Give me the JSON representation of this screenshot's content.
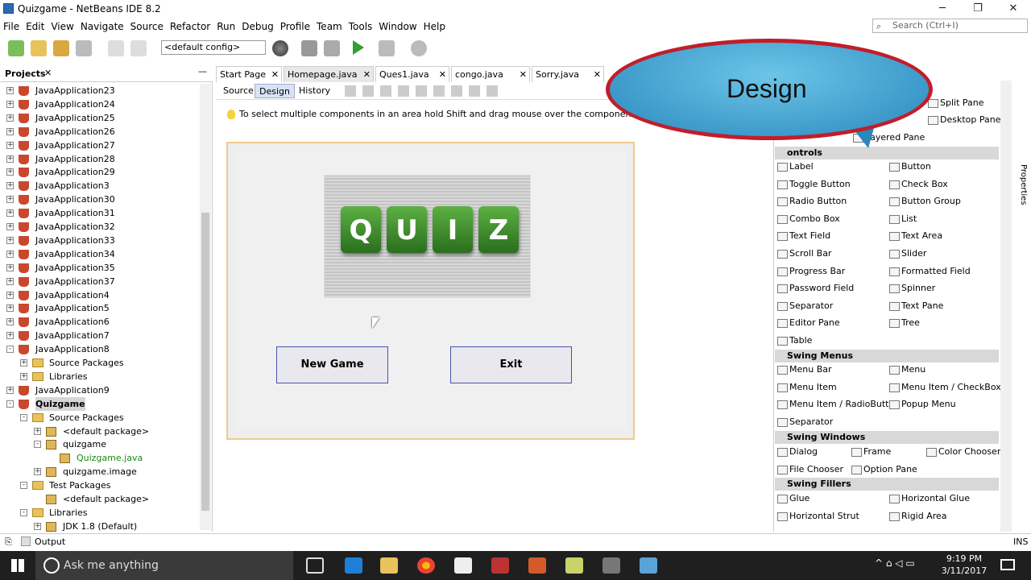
{
  "window": {
    "title": "Quizgame - NetBeans IDE 8.2"
  },
  "menubar": {
    "items": [
      "File",
      "Edit",
      "View",
      "Navigate",
      "Source",
      "Refactor",
      "Run",
      "Debug",
      "Profile",
      "Team",
      "Tools",
      "Window",
      "Help"
    ]
  },
  "search": {
    "placeholder": "Search (Ctrl+I)"
  },
  "toolbar": {
    "config": "<default config>"
  },
  "projects": {
    "title": "Projects",
    "items": [
      {
        "label": "JavaApplication23",
        "level": 0,
        "kind": "project",
        "exp": "+"
      },
      {
        "label": "JavaApplication24",
        "level": 0,
        "kind": "project",
        "exp": "+"
      },
      {
        "label": "JavaApplication25",
        "level": 0,
        "kind": "project",
        "exp": "+"
      },
      {
        "label": "JavaApplication26",
        "level": 0,
        "kind": "project",
        "exp": "+"
      },
      {
        "label": "JavaApplication27",
        "level": 0,
        "kind": "project",
        "exp": "+"
      },
      {
        "label": "JavaApplication28",
        "level": 0,
        "kind": "project",
        "exp": "+"
      },
      {
        "label": "JavaApplication29",
        "level": 0,
        "kind": "project",
        "exp": "+"
      },
      {
        "label": "JavaApplication3",
        "level": 0,
        "kind": "project",
        "exp": "+"
      },
      {
        "label": "JavaApplication30",
        "level": 0,
        "kind": "project",
        "exp": "+"
      },
      {
        "label": "JavaApplication31",
        "level": 0,
        "kind": "project",
        "exp": "+"
      },
      {
        "label": "JavaApplication32",
        "level": 0,
        "kind": "project",
        "exp": "+"
      },
      {
        "label": "JavaApplication33",
        "level": 0,
        "kind": "project",
        "exp": "+"
      },
      {
        "label": "JavaApplication34",
        "level": 0,
        "kind": "project",
        "exp": "+"
      },
      {
        "label": "JavaApplication35",
        "level": 0,
        "kind": "project",
        "exp": "+"
      },
      {
        "label": "JavaApplication37",
        "level": 0,
        "kind": "project",
        "exp": "+"
      },
      {
        "label": "JavaApplication4",
        "level": 0,
        "kind": "project",
        "exp": "+"
      },
      {
        "label": "JavaApplication5",
        "level": 0,
        "kind": "project",
        "exp": "+"
      },
      {
        "label": "JavaApplication6",
        "level": 0,
        "kind": "project",
        "exp": "+"
      },
      {
        "label": "JavaApplication7",
        "level": 0,
        "kind": "project",
        "exp": "+"
      },
      {
        "label": "JavaApplication8",
        "level": 0,
        "kind": "project",
        "exp": "-"
      },
      {
        "label": "Source Packages",
        "level": 1,
        "kind": "folder",
        "exp": "+"
      },
      {
        "label": "Libraries",
        "level": 1,
        "kind": "folder",
        "exp": "+"
      },
      {
        "label": "JavaApplication9",
        "level": 0,
        "kind": "project",
        "exp": "+"
      },
      {
        "label": "Quizgame",
        "level": 0,
        "kind": "project",
        "exp": "-",
        "bold": true
      },
      {
        "label": "Source Packages",
        "level": 1,
        "kind": "folder",
        "exp": "-"
      },
      {
        "label": "<default package>",
        "level": 2,
        "kind": "pkg",
        "exp": "+"
      },
      {
        "label": "quizgame",
        "level": 2,
        "kind": "pkg",
        "exp": "-"
      },
      {
        "label": "Quizgame.java",
        "level": 3,
        "kind": "file",
        "exp": "",
        "green": true
      },
      {
        "label": "quizgame.image",
        "level": 2,
        "kind": "pkg",
        "exp": "+"
      },
      {
        "label": "Test Packages",
        "level": 1,
        "kind": "folder",
        "exp": "-"
      },
      {
        "label": "<default package>",
        "level": 2,
        "kind": "pkg",
        "exp": ""
      },
      {
        "label": "Libraries",
        "level": 1,
        "kind": "folder",
        "exp": "-"
      },
      {
        "label": "JDK 1.8 (Default)",
        "level": 2,
        "kind": "pkg",
        "exp": "+"
      }
    ]
  },
  "editor": {
    "tabs": [
      "Start Page",
      "Homepage.java",
      "Ques1.java",
      "congo.java",
      "Sorry.java"
    ],
    "subtabs": [
      "Source",
      "Design",
      "History"
    ],
    "hint": "To select multiple components in an area hold Shift and drag mouse over the components.",
    "quiz_letters": [
      "Q",
      "U",
      "I",
      "Z"
    ],
    "new_game_label": "New Game",
    "exit_label": "Exit"
  },
  "bubble": {
    "text": "Design"
  },
  "palette": {
    "top_items": [
      "Split Pane",
      "Desktop Pane",
      "Layered Pane"
    ],
    "swing_controls_partial": "ontrols",
    "controls": [
      [
        "Label",
        "Button"
      ],
      [
        "Toggle Button",
        "Check Box"
      ],
      [
        "Radio Button",
        "Button Group"
      ],
      [
        "Combo Box",
        "List"
      ],
      [
        "Text Field",
        "Text Area"
      ],
      [
        "Scroll Bar",
        "Slider"
      ],
      [
        "Progress Bar",
        "Formatted Field"
      ],
      [
        "Password Field",
        "Spinner"
      ],
      [
        "Separator",
        "Text Pane"
      ],
      [
        "Editor Pane",
        "Tree"
      ],
      [
        "Table",
        ""
      ]
    ],
    "menus_header": "Swing Menus",
    "menus": [
      [
        "Menu Bar",
        "Menu"
      ],
      [
        "Menu Item",
        "Menu Item / CheckBox"
      ],
      [
        "Menu Item / RadioButton",
        "Popup Menu"
      ],
      [
        "Separator",
        ""
      ]
    ],
    "windows_header": "Swing Windows",
    "windows": [
      "Dialog",
      "Frame",
      "Color Chooser",
      "File Chooser",
      "Option Pane"
    ],
    "fillers_header": "Swing Fillers",
    "fillers": [
      [
        "Glue",
        "Horizontal Glue"
      ],
      [
        "Horizontal Strut",
        "Rigid Area"
      ]
    ],
    "side_tab": "Properties"
  },
  "output": {
    "label": "Output",
    "ins": "INS"
  },
  "taskbar": {
    "search": "Ask me anything",
    "time": "9:19 PM",
    "date": "3/11/2017"
  }
}
